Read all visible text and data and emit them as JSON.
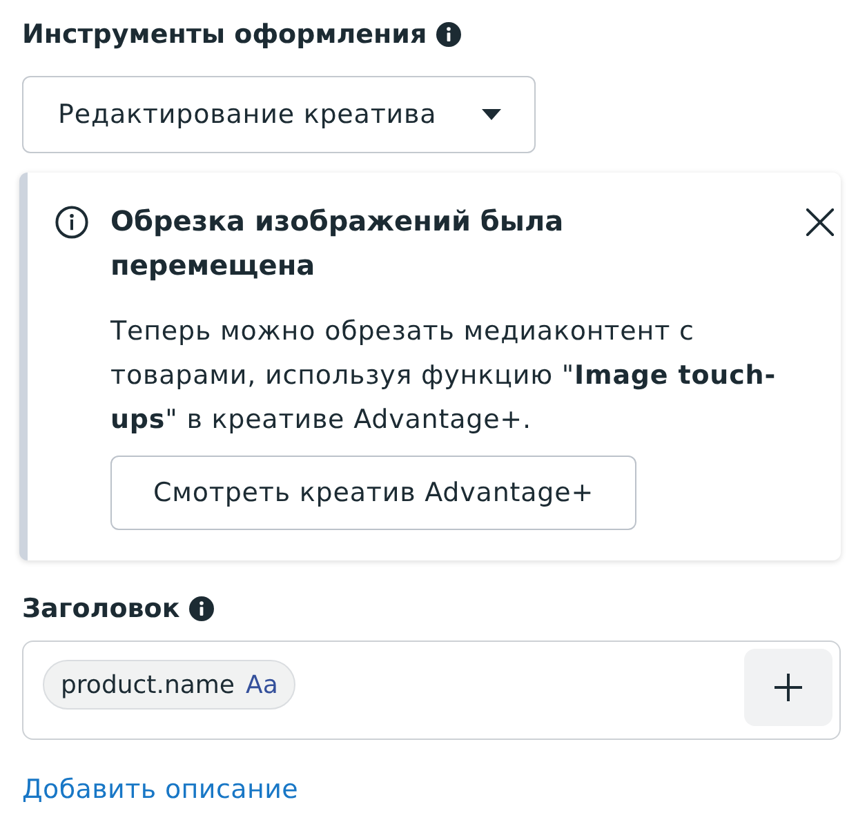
{
  "design_tools": {
    "label": "Инструменты оформления",
    "dropdown": {
      "value": "Редактирование креатива"
    }
  },
  "notice": {
    "title": "Обрезка изображений была перемещена",
    "body": "Теперь можно обрезать медиаконтент с товарами, используя функцию \"**Image touch-ups**\" в креативе Advantage+.",
    "button": "Смотреть креатив Advantage+"
  },
  "headline": {
    "label": "Заголовок",
    "tokens": [
      {
        "name": "product.name",
        "format": "Aa"
      }
    ]
  },
  "add_description_link": "Добавить описание"
}
